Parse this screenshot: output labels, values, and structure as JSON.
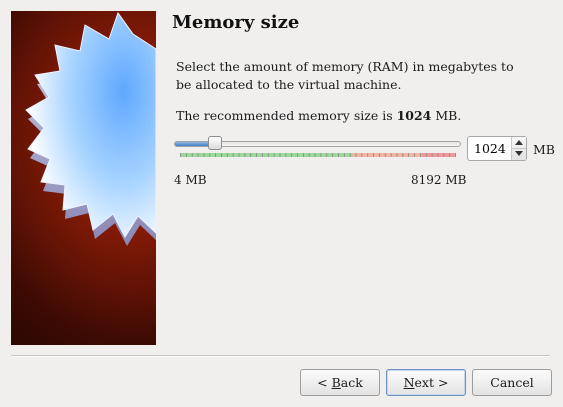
{
  "page": {
    "title": "Memory size",
    "description": "Select the amount of memory (RAM) in megabytes to be allocated to the virtual machine.",
    "recommended_prefix": "The recommended memory size is ",
    "recommended_value": "1024",
    "recommended_suffix": " MB."
  },
  "memory": {
    "value": "1024",
    "unit": "MB",
    "min_label": "4 MB",
    "max_label": "8192 MB",
    "min": 4,
    "max": 8192,
    "current": 1024,
    "zones": [
      {
        "color": "#7fd17f",
        "from": 4,
        "to": 5120
      },
      {
        "color": "#f4a28a",
        "from": 5120,
        "to": 7168
      },
      {
        "color": "#ef7d7d",
        "from": 7168,
        "to": 8192
      }
    ]
  },
  "buttons": {
    "back_mnemonic": "B",
    "back_rest": "ack",
    "back_prefix": "< ",
    "next_mnemonic": "N",
    "next_rest": "ext >",
    "cancel": "Cancel"
  },
  "colors": {
    "accent": "#3f7ec5",
    "banner": "#8b1c06"
  }
}
